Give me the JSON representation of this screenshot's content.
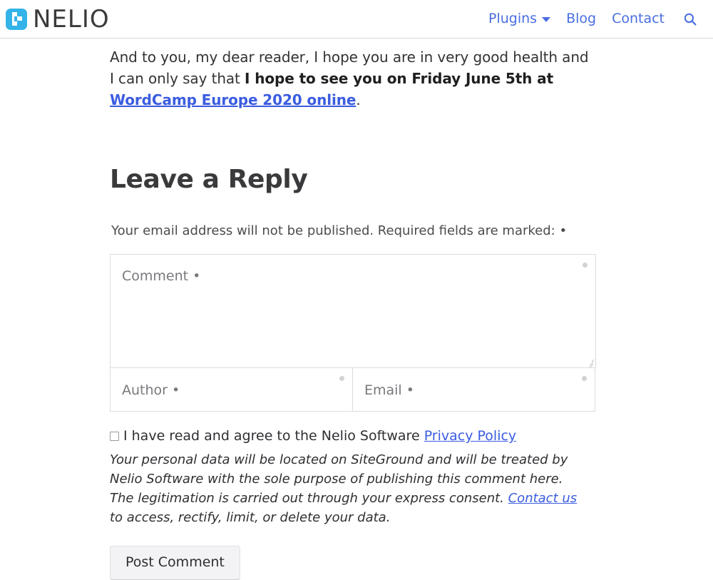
{
  "header": {
    "brand": {
      "word": "NELIO",
      "icon": "nelio-logo-icon"
    },
    "nav": [
      {
        "label": "Plugins",
        "has_dropdown": true
      },
      {
        "label": "Blog",
        "has_dropdown": false
      },
      {
        "label": "Contact",
        "has_dropdown": false
      }
    ],
    "search_icon": "search-icon",
    "link_color": "#4a6ee0",
    "brand_color": "#33b3e8"
  },
  "article": {
    "paragraph_before_link": "And to you, my dear reader, I hope you are in very good health and I can only say that ",
    "paragraph_bold": "I hope to see you on Friday June 5th at ",
    "link_text": "WordCamp Europe 2020 online",
    "paragraph_after_link": "."
  },
  "comments": {
    "title": "Leave a Reply",
    "notice": "Your email address will not be published. Required fields are marked: •",
    "fields": {
      "comment_placeholder": "Comment •",
      "author_placeholder": "Author •",
      "email_placeholder": "Email •"
    },
    "consent": {
      "text_before_link": "I have read and agree to the Nelio Software ",
      "link_text": "Privacy Policy",
      "checked": false
    },
    "privacy_note": {
      "part1": "Your personal data will be located on SiteGround and will be treated by Nelio Software with the sole purpose of publishing this comment here. The legitimation is carried out through your express consent. ",
      "link_text": "Contact us",
      "part2": " to access, rectify, limit, or delete your data."
    },
    "submit_label": "Post Comment"
  }
}
